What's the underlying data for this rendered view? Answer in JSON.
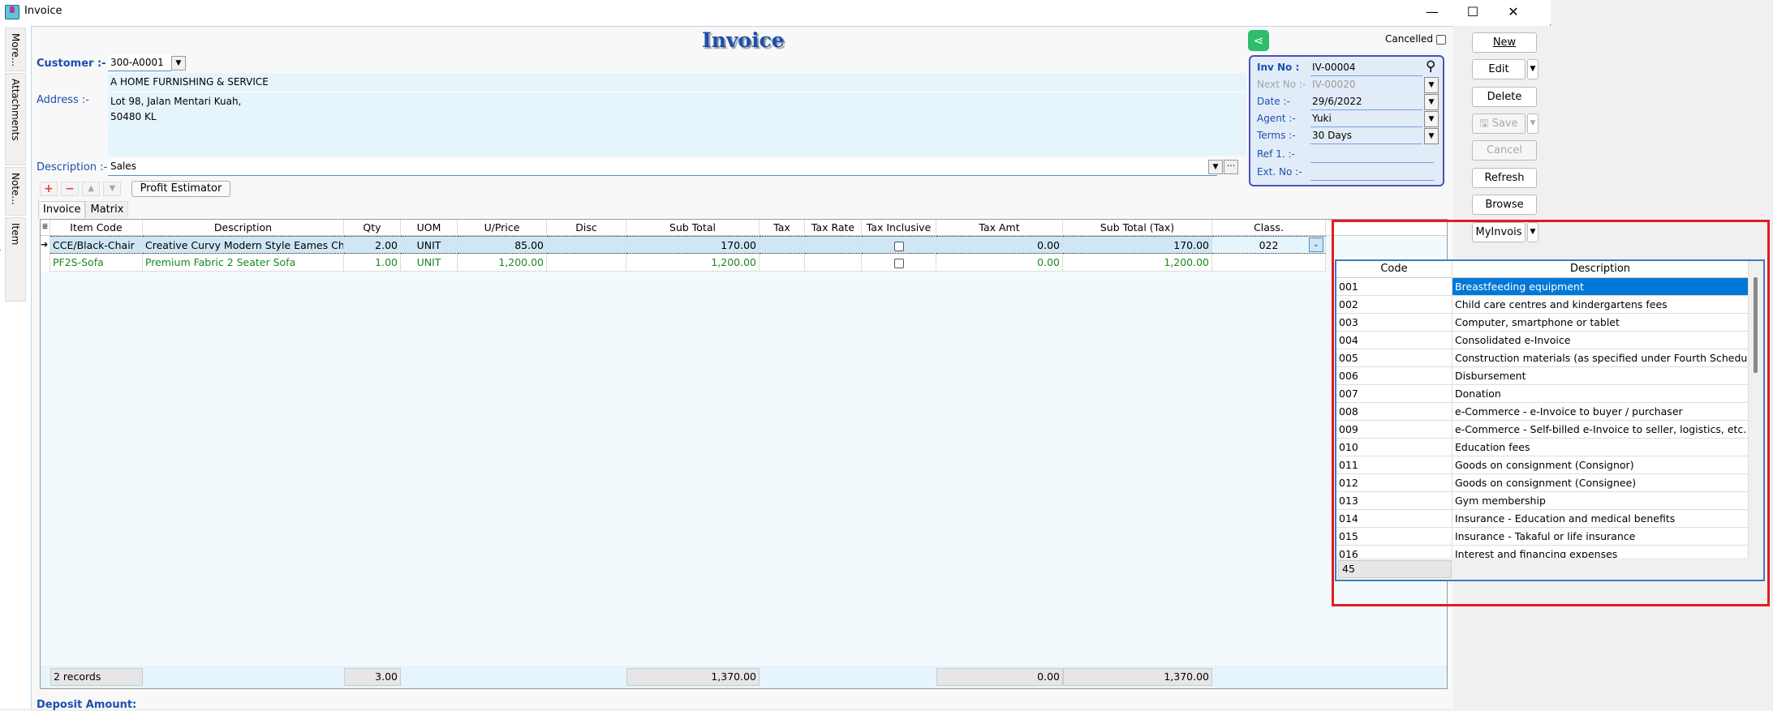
{
  "window": {
    "title": "Invoice",
    "minimize": "—",
    "maximize": "☐",
    "close": "✕"
  },
  "side_tabs": [
    "More...",
    "Attachments",
    "Note...",
    "Item Template..."
  ],
  "header": {
    "title": "Invoice",
    "customer_label": "Customer :-",
    "customer_code": "300-A0001",
    "customer_name": "A HOME FURNISHING & SERVICE",
    "address_label": "Address :-",
    "address_line1": "Lot 98, Jalan Mentari Kuah,",
    "address_line2": "50480 KL",
    "description_label": "Description :-",
    "description_value": "Sales",
    "cancelled_label": "Cancelled",
    "cancelled_checked": false
  },
  "inv_box": {
    "inv_no_label": "Inv No :",
    "inv_no": "IV-00004",
    "next_no_label": "Next No :-",
    "next_no": "IV-00020",
    "date_label": "Date :-",
    "date": "29/6/2022",
    "agent_label": "Agent :-",
    "agent": "Yuki",
    "terms_label": "Terms :-",
    "terms": "30 Days",
    "ref1_label": "Ref 1. :-",
    "ref1": "",
    "ext_no_label": "Ext. No :-",
    "ext_no": ""
  },
  "mini_toolbar": {
    "profit_estimator": "Profit Estimator"
  },
  "tabs": [
    {
      "label": "Invoice",
      "active": true
    },
    {
      "label": "Matrix",
      "active": false
    }
  ],
  "grid": {
    "columns": [
      "Item Code",
      "Description",
      "Qty",
      "UOM",
      "U/Price",
      "Disc",
      "Sub Total",
      "Tax",
      "Tax Rate",
      "Tax Inclusive",
      "Tax Amt",
      "Sub Total (Tax)",
      "Class."
    ],
    "rows": [
      {
        "item_code": "CCE/Black-Chair",
        "description": "Creative Curvy Modern Style Eames Chair (Black)",
        "qty": "2.00",
        "uom": "UNIT",
        "uprice": "85.00",
        "disc": "",
        "subtotal": "170.00",
        "tax": "",
        "tax_rate": "",
        "tax_inclusive": false,
        "tax_amt": "0.00",
        "subtotal_tax": "170.00",
        "class": "022"
      },
      {
        "item_code": "PF2S-Sofa",
        "description": "Premium Fabric 2 Seater Sofa",
        "qty": "1.00",
        "uom": "UNIT",
        "uprice": "1,200.00",
        "disc": "",
        "subtotal": "1,200.00",
        "tax": "",
        "tax_rate": "",
        "tax_inclusive": false,
        "tax_amt": "0.00",
        "subtotal_tax": "1,200.00",
        "class": ""
      }
    ],
    "footer": {
      "records": "2 records",
      "qty": "3.00",
      "subtotal": "1,370.00",
      "tax_amt": "0.00",
      "subtotal_tax": "1,370.00"
    }
  },
  "class_dropdown": {
    "columns": [
      "Code",
      "Description"
    ],
    "items": [
      {
        "code": "001",
        "desc": "Breastfeeding equipment"
      },
      {
        "code": "002",
        "desc": "Child care centres and kindergartens fees"
      },
      {
        "code": "003",
        "desc": "Computer, smartphone or tablet"
      },
      {
        "code": "004",
        "desc": "Consolidated e-Invoice"
      },
      {
        "code": "005",
        "desc": "Construction materials (as specified under Fourth Schedule of"
      },
      {
        "code": "006",
        "desc": "Disbursement"
      },
      {
        "code": "007",
        "desc": "Donation"
      },
      {
        "code": "008",
        "desc": "e-Commerce - e-Invoice to buyer / purchaser"
      },
      {
        "code": "009",
        "desc": "e-Commerce - Self-billed e-Invoice to seller, logistics, etc."
      },
      {
        "code": "010",
        "desc": "Education fees"
      },
      {
        "code": "011",
        "desc": "Goods on consignment (Consignor)"
      },
      {
        "code": "012",
        "desc": "Goods on consignment (Consignee)"
      },
      {
        "code": "013",
        "desc": "Gym membership"
      },
      {
        "code": "014",
        "desc": "Insurance - Education and medical benefits"
      },
      {
        "code": "015",
        "desc": "Insurance - Takaful or life insurance"
      },
      {
        "code": "016",
        "desc": "Interest and financing expenses"
      }
    ],
    "selected_code": "001",
    "count": "45"
  },
  "side_buttons": {
    "new": "New",
    "edit": "Edit",
    "delete": "Delete",
    "save": "Save",
    "cancel": "Cancel",
    "refresh": "Refresh",
    "browse": "Browse",
    "myinvois": "MyInvois"
  },
  "deposit_label": "Deposit Amount:",
  "colors": {
    "accent": "#1c4fae",
    "selection": "#0078d7",
    "highlight_box": "#e31b23",
    "share": "#2ebd6b"
  }
}
